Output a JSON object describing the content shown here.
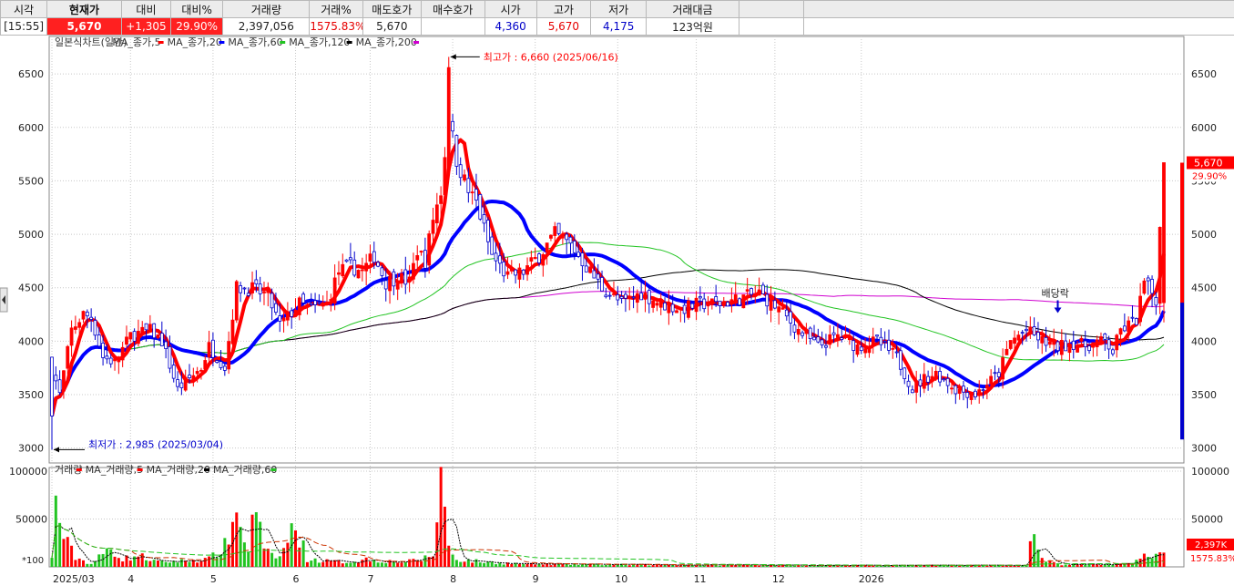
{
  "quote": {
    "headers": [
      "시각",
      "현재가",
      "대비",
      "대비%",
      "거래량",
      "거래%",
      "매도호가",
      "매수호가",
      "시가",
      "고가",
      "저가",
      "거래대금"
    ],
    "time": "[15:55]",
    "current_price": "5,670",
    "change": "+1,305",
    "change_pct": "29.90%",
    "volume": "2,397,056",
    "volume_pct": "1575.83%",
    "ask": "5,670",
    "bid": "",
    "open": "4,360",
    "high": "5,670",
    "low": "4,175",
    "trade_value": "123억원"
  },
  "colors": {
    "up": "#ff0000",
    "down": "#0000cc",
    "ma5": "#ff0000",
    "ma20": "#0000ff",
    "ma60": "#22c422",
    "ma120": "#000000",
    "ma200": "#d000d0"
  },
  "price_legend": [
    {
      "text": "일본식차트(일간)",
      "color": "#333333",
      "mark": ""
    },
    {
      "text": "MA_종가,5",
      "color": "#333333",
      "mark": "#ff0000"
    },
    {
      "text": "MA_종가,20",
      "color": "#333333",
      "mark": "#0000ff"
    },
    {
      "text": "MA_종가,60",
      "color": "#333333",
      "mark": "#22c422"
    },
    {
      "text": "MA_종가,120",
      "color": "#333333",
      "mark": "#000000"
    },
    {
      "text": "MA_종가,200",
      "color": "#333333",
      "mark": "#d000d0"
    }
  ],
  "volume_legend": [
    {
      "text": "거래량",
      "color": "#333333",
      "mark": "#ff0000"
    },
    {
      "text": "MA_거래량,5",
      "color": "#333333",
      "mark": "#ff0000"
    },
    {
      "text": "MA_거래량,20",
      "color": "#333333",
      "mark": "#000000"
    },
    {
      "text": "MA_거래량,60",
      "color": "#333333",
      "mark": "#22c422"
    }
  ],
  "chart_data": {
    "type": "candlestick",
    "title": "일본식차트(일간)",
    "price_axis": {
      "ticks": [
        3000,
        3500,
        4000,
        4500,
        5000,
        5500,
        6000,
        6500
      ],
      "labels": [
        "3000",
        "3500",
        "4000",
        "4500",
        "5000",
        "5500",
        "6000",
        "6500"
      ],
      "range": [
        2860,
        6800
      ]
    },
    "volume_axis": {
      "ticks": [
        50000,
        100000
      ],
      "labels": [
        "50000",
        "100000"
      ],
      "unit_label": "*100",
      "range": [
        0,
        100000
      ]
    },
    "x_labels": [
      "2025/03",
      "4",
      "5",
      "6",
      "7",
      "8",
      "9",
      "10",
      "11",
      "12",
      "2026"
    ],
    "annotations": {
      "high": {
        "text": "최고가 : 6,660 (2025/06/16)",
        "value": 6660
      },
      "low": {
        "text": "최저가 : 2,985 (2025/03/04)",
        "value": 2985
      },
      "dividend": {
        "text": "배당락"
      }
    },
    "current_price_label": "5,670",
    "current_pct_label": "29.90%",
    "volume_last_label": "2,397K",
    "volume_pct_label": "1575.83%",
    "close_keyframes": [
      [
        0,
        3750
      ],
      [
        2,
        3500
      ],
      [
        5,
        4100
      ],
      [
        8,
        4250
      ],
      [
        10,
        4220
      ],
      [
        13,
        3850
      ],
      [
        16,
        3800
      ],
      [
        20,
        4050
      ],
      [
        25,
        4100
      ],
      [
        28,
        4000
      ],
      [
        32,
        3550
      ],
      [
        35,
        3650
      ],
      [
        38,
        3750
      ],
      [
        40,
        3950
      ],
      [
        44,
        3760
      ],
      [
        47,
        4500
      ],
      [
        51,
        4490
      ],
      [
        55,
        4420
      ],
      [
        58,
        4150
      ],
      [
        63,
        4350
      ],
      [
        66,
        4300
      ],
      [
        70,
        4350
      ],
      [
        73,
        4650
      ],
      [
        76,
        4700
      ],
      [
        79,
        4650
      ],
      [
        82,
        4800
      ],
      [
        85,
        4550
      ],
      [
        88,
        4600
      ],
      [
        91,
        4550
      ],
      [
        93,
        4850
      ],
      [
        95,
        4750
      ],
      [
        97,
        5150
      ],
      [
        99,
        5400
      ],
      [
        101,
        6100
      ],
      [
        103,
        5700
      ],
      [
        106,
        5400
      ],
      [
        108,
        5300
      ],
      [
        112,
        4800
      ],
      [
        116,
        4600
      ],
      [
        120,
        4650
      ],
      [
        124,
        4800
      ],
      [
        128,
        5000
      ],
      [
        132,
        4900
      ],
      [
        135,
        4750
      ],
      [
        140,
        4500
      ],
      [
        145,
        4350
      ],
      [
        150,
        4450
      ],
      [
        155,
        4350
      ],
      [
        160,
        4300
      ],
      [
        165,
        4350
      ],
      [
        170,
        4350
      ],
      [
        175,
        4400
      ],
      [
        180,
        4450
      ],
      [
        185,
        4300
      ],
      [
        190,
        4100
      ],
      [
        195,
        3950
      ],
      [
        200,
        4050
      ],
      [
        205,
        3950
      ],
      [
        210,
        4000
      ],
      [
        215,
        3850
      ],
      [
        219,
        3550
      ],
      [
        222,
        3650
      ],
      [
        225,
        3700
      ],
      [
        230,
        3550
      ],
      [
        235,
        3500
      ],
      [
        238,
        3600
      ],
      [
        241,
        3700
      ],
      [
        244,
        4000
      ],
      [
        248,
        4100
      ],
      [
        252,
        4000
      ],
      [
        256,
        3950
      ],
      [
        260,
        3980
      ],
      [
        263,
        3960
      ],
      [
        268,
        4000
      ],
      [
        270,
        3900
      ],
      [
        272,
        4100
      ],
      [
        276,
        4200
      ],
      [
        278,
        4550
      ],
      [
        281,
        4400
      ],
      [
        283,
        5670
      ]
    ],
    "volume_keyframes": [
      [
        0,
        8000
      ],
      [
        1,
        72000
      ],
      [
        3,
        30000
      ],
      [
        6,
        10000
      ],
      [
        10,
        3000
      ],
      [
        15,
        20000
      ],
      [
        18,
        8000
      ],
      [
        22,
        12000
      ],
      [
        27,
        5000
      ],
      [
        32,
        6000
      ],
      [
        40,
        8000
      ],
      [
        45,
        25000
      ],
      [
        46,
        65000
      ],
      [
        48,
        40000
      ],
      [
        50,
        20000
      ],
      [
        52,
        65000
      ],
      [
        54,
        15000
      ],
      [
        58,
        10000
      ],
      [
        62,
        45000
      ],
      [
        65,
        8000
      ],
      [
        70,
        6000
      ],
      [
        75,
        5000
      ],
      [
        80,
        8000
      ],
      [
        85,
        6000
      ],
      [
        90,
        5000
      ],
      [
        94,
        8000
      ],
      [
        97,
        12000
      ],
      [
        99,
        99000
      ],
      [
        101,
        20000
      ],
      [
        103,
        8000
      ],
      [
        110,
        5000
      ],
      [
        120,
        3000
      ],
      [
        140,
        2500
      ],
      [
        160,
        2000
      ],
      [
        180,
        2000
      ],
      [
        200,
        1500
      ],
      [
        220,
        1500
      ],
      [
        240,
        1800
      ],
      [
        248,
        1500
      ],
      [
        249,
        35000
      ],
      [
        252,
        8000
      ],
      [
        256,
        2500
      ],
      [
        265,
        2500
      ],
      [
        275,
        3000
      ],
      [
        278,
        10000
      ],
      [
        280,
        12000
      ],
      [
        283,
        24000
      ]
    ]
  }
}
